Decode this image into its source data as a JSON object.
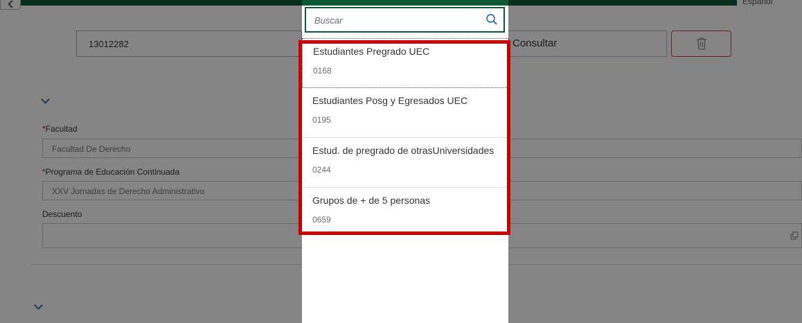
{
  "header": {
    "language": "Español"
  },
  "search_form": {
    "id_value": "13012282",
    "consult_label": "Consultar"
  },
  "form": {
    "facultad_label": "Facultad",
    "facultad_value": "Facultad De Derecho",
    "programa_label": "Programa de Educación Continuada",
    "programa_value": "XXV Jornadas de Derecho Administrativo",
    "descuento_label": "Descuento",
    "required_mark": "*"
  },
  "dialog": {
    "search_placeholder": "Buscar",
    "items": [
      {
        "title": "Estudiantes Pregrado UEC",
        "code": "0168"
      },
      {
        "title": "Estudiantes Posg y Egresados UEC",
        "code": "0195"
      },
      {
        "title": "Estud. de pregrado de otrasUniversidades",
        "code": "0244"
      },
      {
        "title": "Grupos de + de 5 personas",
        "code": "0659"
      }
    ]
  },
  "colors": {
    "brand_green": "#0b5a36",
    "highlight_red": "#cc0000",
    "delete_red": "#d43c3c"
  },
  "icons": [
    "back-arrow-icon",
    "trash-icon",
    "chevron-down-icon",
    "value-help-icon",
    "search-icon"
  ]
}
